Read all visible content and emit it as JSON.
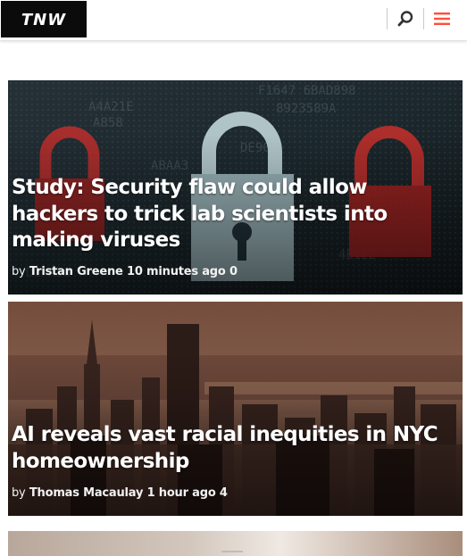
{
  "header": {
    "logo_text": "TNW",
    "search_icon": "search-icon",
    "menu_icon": "hamburger-menu-icon",
    "accent_color": "#ff4f38"
  },
  "articles": [
    {
      "title": "Study: Security flaw could allow hackers to trick lab scientists into making viruses",
      "by": "by",
      "author": "Tristan Greene",
      "time": "10 minutes ago",
      "comments": "0"
    },
    {
      "title": "AI reveals vast racial inequities in NYC homeownership",
      "by": "by",
      "author": "Thomas Macaulay",
      "time": "1 hour ago",
      "comments": "4"
    }
  ]
}
